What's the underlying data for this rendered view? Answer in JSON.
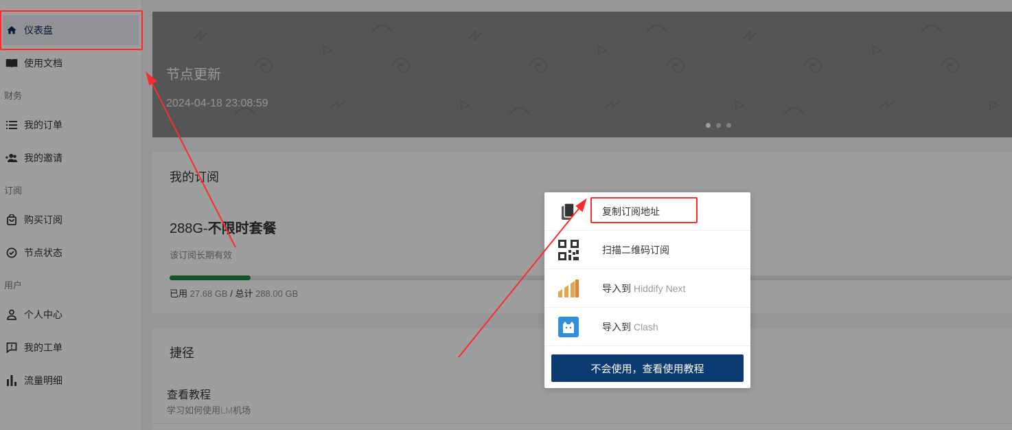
{
  "sidebar": {
    "items": [
      {
        "label": "仪表盘",
        "icon": "home-icon"
      },
      {
        "label": "使用文档",
        "icon": "book-icon"
      },
      {
        "label": "我的订单",
        "icon": "list-icon"
      },
      {
        "label": "我的邀请",
        "icon": "invite-users-icon"
      },
      {
        "label": "购买订阅",
        "icon": "shopping-bag-icon"
      },
      {
        "label": "节点状态",
        "icon": "check-circle-icon"
      },
      {
        "label": "个人中心",
        "icon": "user-icon"
      },
      {
        "label": "我的工单",
        "icon": "ticket-alert-icon"
      },
      {
        "label": "流量明细",
        "icon": "bar-chart-icon"
      }
    ],
    "groups": {
      "finance": "财务",
      "subscribe": "订阅",
      "user": "用户"
    }
  },
  "banner": {
    "title": "节点更新",
    "time": "2024-04-18 23:08:59"
  },
  "subscription": {
    "title": "我的订阅",
    "plan_prefix": "288G-",
    "plan_bold": "不限时套餐",
    "validity": "该订阅长期有效",
    "used_fraction": 0.096,
    "used_label": "已用",
    "used_value": "27.68 GB",
    "separator": "/",
    "total_label": "总计",
    "total_value": "288.00 GB"
  },
  "shortcuts": {
    "title": "捷径",
    "item_title": "查看教程",
    "item_desc_prefix": "学习如何使用",
    "item_desc_brand": "LM",
    "item_desc_suffix": "机场"
  },
  "menu": {
    "copy": "复制订阅地址",
    "scan": "扫描二维码订阅",
    "hiddify_prefix": "导入到",
    "hiddify_name": "Hiddify Next",
    "clash_prefix": "导入到",
    "clash_name": "Clash",
    "tutorial_button": "不会使用，查看使用教程"
  },
  "colors": {
    "accent": "#0c3b72",
    "progress": "#1f8a3a",
    "annotation": "#ff2a2a"
  }
}
